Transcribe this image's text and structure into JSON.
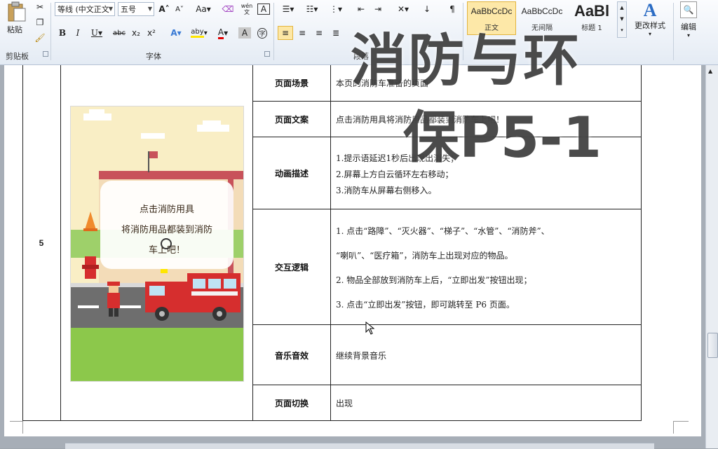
{
  "ribbon": {
    "clipboard": {
      "paste_label": "粘贴",
      "group_label": "剪贴板"
    },
    "font": {
      "font_name": "等线 (中文正文",
      "font_size": "五号",
      "group_label": "字体",
      "buttons": {
        "grow": "A",
        "shrink": "A",
        "case": "Aa",
        "pinyin": "wén",
        "char_border": "A",
        "bold": "B",
        "italic": "I",
        "underline": "U",
        "strike": "abc",
        "subscript": "x₂",
        "superscript": "x²",
        "effects": "A",
        "highlight": "aby",
        "font_color": "A",
        "shading": "A",
        "enclose": "字"
      }
    },
    "paragraph": {
      "group_label": "段落"
    },
    "styles": {
      "items": [
        {
          "preview": "AaBbCcDc",
          "name": "正文"
        },
        {
          "preview": "AaBbCcDc",
          "name": "无间隔"
        },
        {
          "preview": "AaBl",
          "name": "标题 1"
        }
      ],
      "change_styles": "更改样式"
    },
    "editing": {
      "label": "编辑"
    }
  },
  "table": {
    "row_number": "5",
    "rows": [
      {
        "label": "页面场景",
        "lines": [
          "本页的消防车准备的页面"
        ]
      },
      {
        "label": "页面文案",
        "lines": [
          "点击消防用具将消防用品都装到消防车上吧！"
        ]
      },
      {
        "label": "动画描述",
        "lines": [
          "1.提示语延迟1秒后出现出消失；",
          "2.屏幕上方白云循环左右移动；",
          "3.消防车从屏幕右侧移入。"
        ]
      },
      {
        "label": "交互逻辑",
        "lines": [
          "1.  点击“路障”、“灭火器”、“梯子”、“水管”、“消防斧”、",
          "     “喇叭”、“医疗箱”，消防车上出现对应的物品。",
          "2.  物品全部放到消防车上后，“立即出发”按钮出现；",
          "3.  点击“立即出发”按钮，即可跳转至 P6 页面。"
        ]
      },
      {
        "label": "音乐音效",
        "lines": [
          "继续背景音乐"
        ]
      },
      {
        "label": "页面切换",
        "lines": [
          "出现"
        ]
      }
    ]
  },
  "illustration": {
    "bubble_lines": [
      "点击消防用具",
      "将消防用品都装到消防",
      "车上吧！"
    ]
  },
  "watermark": {
    "line1": "消防与环",
    "line2": "保P5-1"
  },
  "colors": {
    "ribbon_bg": "#e4ebf4",
    "sky": "#f9eec5",
    "grass": "#8cc84b",
    "road": "#6e6e6e",
    "truck_red": "#d62e2e"
  }
}
